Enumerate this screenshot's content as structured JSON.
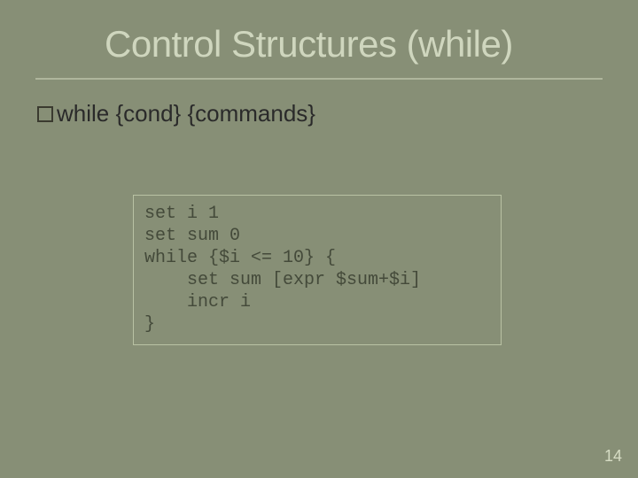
{
  "title": "Control Structures (while)",
  "bullet": {
    "text": "while {cond} {commands}"
  },
  "code": {
    "l1": "set i 1",
    "l2": "set sum 0",
    "l3": "while {$i <= 10} {",
    "l4": "    set sum [expr $sum+$i]",
    "l5": "    incr i",
    "l6": "}"
  },
  "page_number": "14"
}
